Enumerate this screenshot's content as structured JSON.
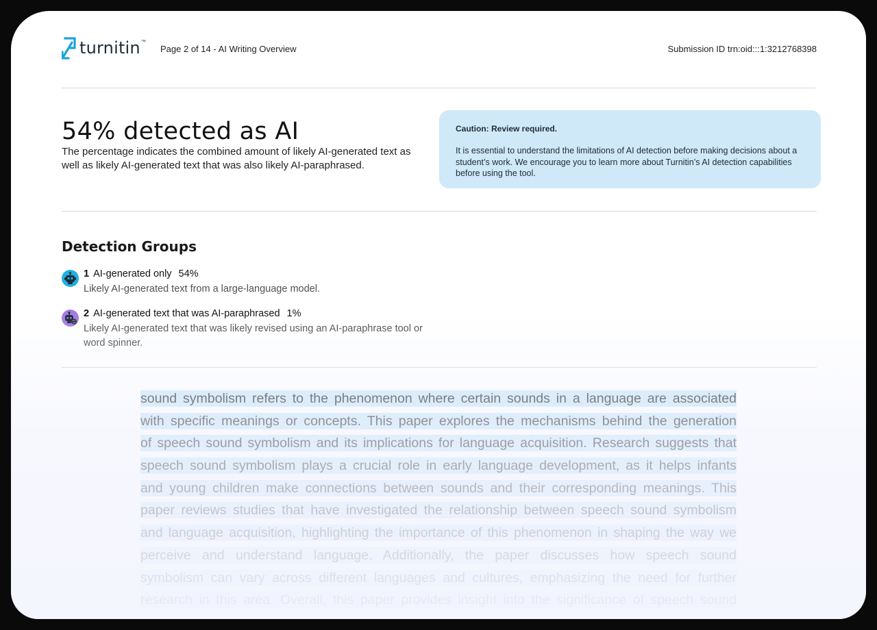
{
  "header": {
    "logo_text": "turnitin",
    "logo_tm": "™",
    "page_info": "Page 2 of 14 - AI Writing Overview",
    "submission_id": "Submission ID trn:oid:::1:3212768398"
  },
  "summary": {
    "headline": "54% detected as AI",
    "explanation": "The percentage indicates the combined amount of likely AI-generated text as well as likely AI-generated text that was also likely AI-paraphrased."
  },
  "caution": {
    "title": "Caution: Review required.",
    "body": "It is essential to understand the limitations of AI detection before making decisions about a student’s work. We encourage you to learn more about Turnitin’s AI detection capabilities before using the tool."
  },
  "groups": {
    "title": "Detection Groups",
    "items": [
      {
        "number": "1",
        "label": "AI-generated only",
        "percent": "54%",
        "description": "Likely AI-generated text from a large-language model.",
        "icon": "robot-icon",
        "color": "#1fb0e0"
      },
      {
        "number": "2",
        "label": "AI-generated text that was AI-paraphrased",
        "percent": "1%",
        "description": "Likely AI-generated text that was likely revised using an AI-paraphrase tool or word spinner.",
        "icon": "robot-paraphrase-icon",
        "color": "#a47be0"
      }
    ]
  },
  "document_text": {
    "lines": [
      "sound symbolism refers to the phenomenon where certain sounds in a language are associated",
      "with specific meanings or concepts. This paper explores the mechanisms behind the generation",
      "of speech sound symbolism and its implications for language acquisition. Research suggests that",
      "speech sound symbolism plays a crucial role in early language development, as it helps infants",
      "and young children make connections between sounds and their corresponding meanings. This",
      "paper reviews studies that have investigated the relationship between speech sound symbolism",
      "and language acquisition, highlighting the importance of this phenomenon in shaping the way we",
      "perceive and understand language. Additionally, the paper discusses how speech sound",
      "symbolism can vary across different languages and cultures, emphasizing the need for further",
      "research in this area. Overall, this paper provides insight into the significance of speech sound"
    ],
    "highlight_color": "#cfe9f8"
  }
}
